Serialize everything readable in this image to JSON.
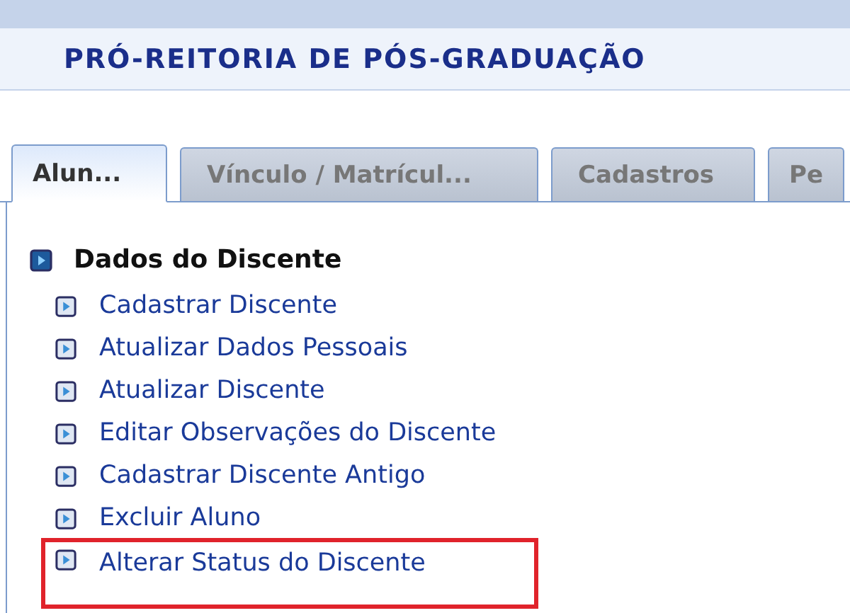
{
  "header": {
    "title": "PRÓ-REITORIA DE PÓS-GRADUAÇÃO"
  },
  "tabs": [
    {
      "label": "Alun...",
      "selected": true
    },
    {
      "label": "Vínculo / Matrícul...",
      "selected": false
    },
    {
      "label": "Cadastros",
      "selected": false
    },
    {
      "label": "Pe",
      "selected": false
    }
  ],
  "section": {
    "title": "Dados do Discente",
    "items": [
      {
        "label": "Cadastrar Discente",
        "highlighted": false
      },
      {
        "label": "Atualizar Dados Pessoais",
        "highlighted": false
      },
      {
        "label": "Atualizar Discente",
        "highlighted": false
      },
      {
        "label": "Editar Observações do Discente",
        "highlighted": false
      },
      {
        "label": "Cadastrar Discente Antigo",
        "highlighted": false
      },
      {
        "label": "Excluir Aluno",
        "highlighted": false
      },
      {
        "label": "Alterar Status do Discente",
        "highlighted": true
      }
    ]
  }
}
